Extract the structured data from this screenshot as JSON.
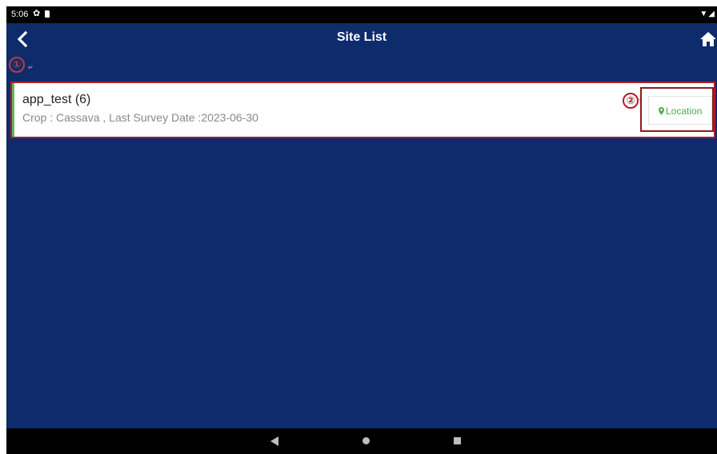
{
  "status_bar": {
    "time": "5:06",
    "icons": [
      "gear-icon",
      "sd-card-icon",
      "wifi-icon",
      "signal-icon",
      "battery-icon"
    ]
  },
  "app_bar": {
    "title": "Site List",
    "back_icon": "chevron-left-icon",
    "home_icon": "home-icon"
  },
  "annotations": {
    "marker_1": "①",
    "marker_2": "②",
    "return_mark": "↵"
  },
  "sites": [
    {
      "name": "app_test (6)",
      "detail": "Crop : Cassava , Last Survey Date :2023-06-30",
      "location_label": "Location",
      "location_icon": "map-marker-icon"
    }
  ],
  "nav_bar": {
    "icons": [
      "back-triangle-icon",
      "home-circle-icon",
      "recents-square-icon"
    ]
  },
  "colors": {
    "background": "#0e2b6c",
    "card": "#ffffff",
    "accent_green": "#5cb85c",
    "annotation_red": "#b01c28",
    "detail_gray": "#888888"
  }
}
